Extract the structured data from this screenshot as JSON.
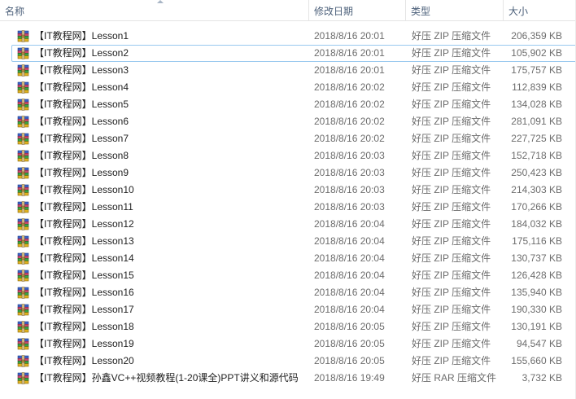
{
  "columns": {
    "name": "名称",
    "date": "修改日期",
    "type": "类型",
    "size": "大小"
  },
  "icon": "winrar-archive-icon",
  "selected_index": 1,
  "files": [
    {
      "name": "【IT教程网】Lesson1",
      "date": "2018/8/16 20:01",
      "type": "好压 ZIP 压缩文件",
      "size": "206,359 KB"
    },
    {
      "name": "【IT教程网】Lesson2",
      "date": "2018/8/16 20:01",
      "type": "好压 ZIP 压缩文件",
      "size": "105,902 KB"
    },
    {
      "name": "【IT教程网】Lesson3",
      "date": "2018/8/16 20:01",
      "type": "好压 ZIP 压缩文件",
      "size": "175,757 KB"
    },
    {
      "name": "【IT教程网】Lesson4",
      "date": "2018/8/16 20:02",
      "type": "好压 ZIP 压缩文件",
      "size": "112,839 KB"
    },
    {
      "name": "【IT教程网】Lesson5",
      "date": "2018/8/16 20:02",
      "type": "好压 ZIP 压缩文件",
      "size": "134,028 KB"
    },
    {
      "name": "【IT教程网】Lesson6",
      "date": "2018/8/16 20:02",
      "type": "好压 ZIP 压缩文件",
      "size": "281,091 KB"
    },
    {
      "name": "【IT教程网】Lesson7",
      "date": "2018/8/16 20:02",
      "type": "好压 ZIP 压缩文件",
      "size": "227,725 KB"
    },
    {
      "name": "【IT教程网】Lesson8",
      "date": "2018/8/16 20:03",
      "type": "好压 ZIP 压缩文件",
      "size": "152,718 KB"
    },
    {
      "name": "【IT教程网】Lesson9",
      "date": "2018/8/16 20:03",
      "type": "好压 ZIP 压缩文件",
      "size": "250,423 KB"
    },
    {
      "name": "【IT教程网】Lesson10",
      "date": "2018/8/16 20:03",
      "type": "好压 ZIP 压缩文件",
      "size": "214,303 KB"
    },
    {
      "name": "【IT教程网】Lesson11",
      "date": "2018/8/16 20:03",
      "type": "好压 ZIP 压缩文件",
      "size": "170,266 KB"
    },
    {
      "name": "【IT教程网】Lesson12",
      "date": "2018/8/16 20:04",
      "type": "好压 ZIP 压缩文件",
      "size": "184,032 KB"
    },
    {
      "name": "【IT教程网】Lesson13",
      "date": "2018/8/16 20:04",
      "type": "好压 ZIP 压缩文件",
      "size": "175,116 KB"
    },
    {
      "name": "【IT教程网】Lesson14",
      "date": "2018/8/16 20:04",
      "type": "好压 ZIP 压缩文件",
      "size": "130,737 KB"
    },
    {
      "name": "【IT教程网】Lesson15",
      "date": "2018/8/16 20:04",
      "type": "好压 ZIP 压缩文件",
      "size": "126,428 KB"
    },
    {
      "name": "【IT教程网】Lesson16",
      "date": "2018/8/16 20:04",
      "type": "好压 ZIP 压缩文件",
      "size": "135,940 KB"
    },
    {
      "name": "【IT教程网】Lesson17",
      "date": "2018/8/16 20:04",
      "type": "好压 ZIP 压缩文件",
      "size": "190,330 KB"
    },
    {
      "name": "【IT教程网】Lesson18",
      "date": "2018/8/16 20:05",
      "type": "好压 ZIP 压缩文件",
      "size": "130,191 KB"
    },
    {
      "name": "【IT教程网】Lesson19",
      "date": "2018/8/16 20:05",
      "type": "好压 ZIP 压缩文件",
      "size": "94,547 KB"
    },
    {
      "name": "【IT教程网】Lesson20",
      "date": "2018/8/16 20:05",
      "type": "好压 ZIP 压缩文件",
      "size": "155,660 KB"
    },
    {
      "name": "【IT教程网】孙鑫VC++视频教程(1-20课全)PPT讲义和源代码",
      "date": "2018/8/16 19:49",
      "type": "好压 RAR 压缩文件",
      "size": "3,732 KB"
    }
  ]
}
